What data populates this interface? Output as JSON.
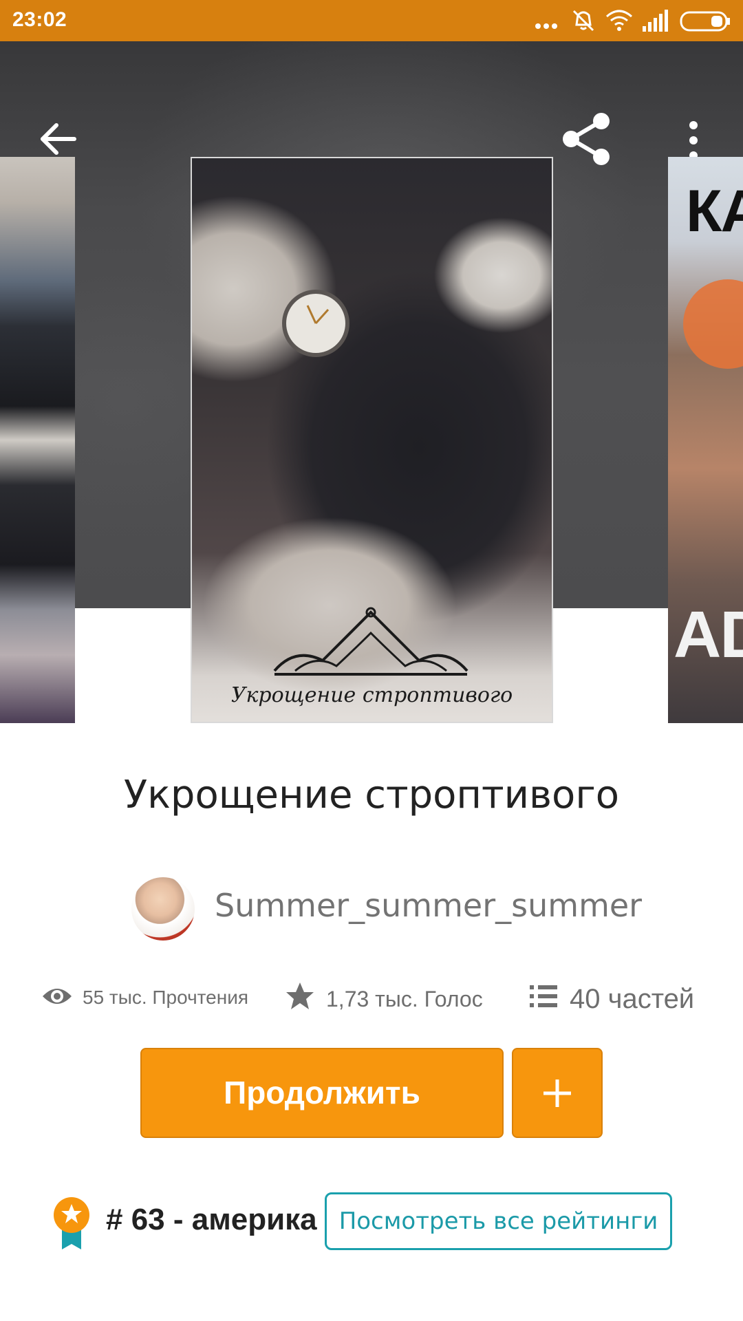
{
  "status_bar": {
    "time": "23:02",
    "icons": [
      "more-dots-icon",
      "vibrate-off-icon",
      "wifi-icon",
      "signal-icon",
      "battery-icon"
    ],
    "background": "#d7800f"
  },
  "toolbar": {
    "back_icon": "arrow-left-icon",
    "share_icon": "share-icon",
    "more_icon": "more-vertical-icon"
  },
  "carousel": {
    "covers": [
      {
        "position": "left",
        "text": ""
      },
      {
        "position": "center",
        "text": "Укрощение строптивого"
      },
      {
        "position": "right",
        "text_top": "КА",
        "text_bottom": "AD"
      }
    ]
  },
  "book": {
    "title": "Укрощение строптивого",
    "author": "Summer_summer_summer"
  },
  "stats": {
    "reads": "55 тыс. Прочтения",
    "votes": "1,73 тыс. Голос",
    "parts": "40 частей"
  },
  "actions": {
    "continue_label": "Продолжить",
    "add_icon": "plus-icon"
  },
  "ranking": {
    "badge_icon": "ranking-ribbon-icon",
    "text": "# 63 - америка",
    "see_all_label": "Посмотреть все рейтинги"
  },
  "colors": {
    "accent": "#f7960d",
    "link": "#1b9aa8"
  }
}
